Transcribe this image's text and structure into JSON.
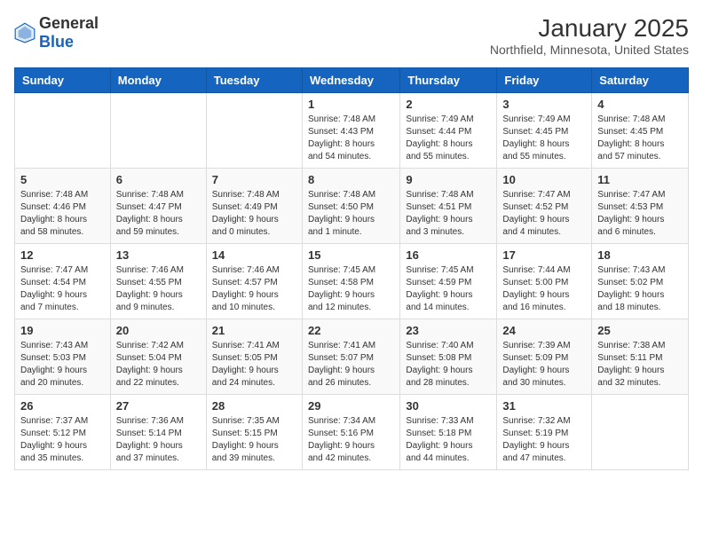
{
  "header": {
    "logo_general": "General",
    "logo_blue": "Blue",
    "month_title": "January 2025",
    "location": "Northfield, Minnesota, United States"
  },
  "days_of_week": [
    "Sunday",
    "Monday",
    "Tuesday",
    "Wednesday",
    "Thursday",
    "Friday",
    "Saturday"
  ],
  "weeks": [
    {
      "days": [
        {
          "num": "",
          "info": ""
        },
        {
          "num": "",
          "info": ""
        },
        {
          "num": "",
          "info": ""
        },
        {
          "num": "1",
          "info": "Sunrise: 7:48 AM\nSunset: 4:43 PM\nDaylight: 8 hours\nand 54 minutes."
        },
        {
          "num": "2",
          "info": "Sunrise: 7:49 AM\nSunset: 4:44 PM\nDaylight: 8 hours\nand 55 minutes."
        },
        {
          "num": "3",
          "info": "Sunrise: 7:49 AM\nSunset: 4:45 PM\nDaylight: 8 hours\nand 55 minutes."
        },
        {
          "num": "4",
          "info": "Sunrise: 7:48 AM\nSunset: 4:45 PM\nDaylight: 8 hours\nand 57 minutes."
        }
      ]
    },
    {
      "days": [
        {
          "num": "5",
          "info": "Sunrise: 7:48 AM\nSunset: 4:46 PM\nDaylight: 8 hours\nand 58 minutes."
        },
        {
          "num": "6",
          "info": "Sunrise: 7:48 AM\nSunset: 4:47 PM\nDaylight: 8 hours\nand 59 minutes."
        },
        {
          "num": "7",
          "info": "Sunrise: 7:48 AM\nSunset: 4:49 PM\nDaylight: 9 hours\nand 0 minutes."
        },
        {
          "num": "8",
          "info": "Sunrise: 7:48 AM\nSunset: 4:50 PM\nDaylight: 9 hours\nand 1 minute."
        },
        {
          "num": "9",
          "info": "Sunrise: 7:48 AM\nSunset: 4:51 PM\nDaylight: 9 hours\nand 3 minutes."
        },
        {
          "num": "10",
          "info": "Sunrise: 7:47 AM\nSunset: 4:52 PM\nDaylight: 9 hours\nand 4 minutes."
        },
        {
          "num": "11",
          "info": "Sunrise: 7:47 AM\nSunset: 4:53 PM\nDaylight: 9 hours\nand 6 minutes."
        }
      ]
    },
    {
      "days": [
        {
          "num": "12",
          "info": "Sunrise: 7:47 AM\nSunset: 4:54 PM\nDaylight: 9 hours\nand 7 minutes."
        },
        {
          "num": "13",
          "info": "Sunrise: 7:46 AM\nSunset: 4:55 PM\nDaylight: 9 hours\nand 9 minutes."
        },
        {
          "num": "14",
          "info": "Sunrise: 7:46 AM\nSunset: 4:57 PM\nDaylight: 9 hours\nand 10 minutes."
        },
        {
          "num": "15",
          "info": "Sunrise: 7:45 AM\nSunset: 4:58 PM\nDaylight: 9 hours\nand 12 minutes."
        },
        {
          "num": "16",
          "info": "Sunrise: 7:45 AM\nSunset: 4:59 PM\nDaylight: 9 hours\nand 14 minutes."
        },
        {
          "num": "17",
          "info": "Sunrise: 7:44 AM\nSunset: 5:00 PM\nDaylight: 9 hours\nand 16 minutes."
        },
        {
          "num": "18",
          "info": "Sunrise: 7:43 AM\nSunset: 5:02 PM\nDaylight: 9 hours\nand 18 minutes."
        }
      ]
    },
    {
      "days": [
        {
          "num": "19",
          "info": "Sunrise: 7:43 AM\nSunset: 5:03 PM\nDaylight: 9 hours\nand 20 minutes."
        },
        {
          "num": "20",
          "info": "Sunrise: 7:42 AM\nSunset: 5:04 PM\nDaylight: 9 hours\nand 22 minutes."
        },
        {
          "num": "21",
          "info": "Sunrise: 7:41 AM\nSunset: 5:05 PM\nDaylight: 9 hours\nand 24 minutes."
        },
        {
          "num": "22",
          "info": "Sunrise: 7:41 AM\nSunset: 5:07 PM\nDaylight: 9 hours\nand 26 minutes."
        },
        {
          "num": "23",
          "info": "Sunrise: 7:40 AM\nSunset: 5:08 PM\nDaylight: 9 hours\nand 28 minutes."
        },
        {
          "num": "24",
          "info": "Sunrise: 7:39 AM\nSunset: 5:09 PM\nDaylight: 9 hours\nand 30 minutes."
        },
        {
          "num": "25",
          "info": "Sunrise: 7:38 AM\nSunset: 5:11 PM\nDaylight: 9 hours\nand 32 minutes."
        }
      ]
    },
    {
      "days": [
        {
          "num": "26",
          "info": "Sunrise: 7:37 AM\nSunset: 5:12 PM\nDaylight: 9 hours\nand 35 minutes."
        },
        {
          "num": "27",
          "info": "Sunrise: 7:36 AM\nSunset: 5:14 PM\nDaylight: 9 hours\nand 37 minutes."
        },
        {
          "num": "28",
          "info": "Sunrise: 7:35 AM\nSunset: 5:15 PM\nDaylight: 9 hours\nand 39 minutes."
        },
        {
          "num": "29",
          "info": "Sunrise: 7:34 AM\nSunset: 5:16 PM\nDaylight: 9 hours\nand 42 minutes."
        },
        {
          "num": "30",
          "info": "Sunrise: 7:33 AM\nSunset: 5:18 PM\nDaylight: 9 hours\nand 44 minutes."
        },
        {
          "num": "31",
          "info": "Sunrise: 7:32 AM\nSunset: 5:19 PM\nDaylight: 9 hours\nand 47 minutes."
        },
        {
          "num": "",
          "info": ""
        }
      ]
    }
  ]
}
